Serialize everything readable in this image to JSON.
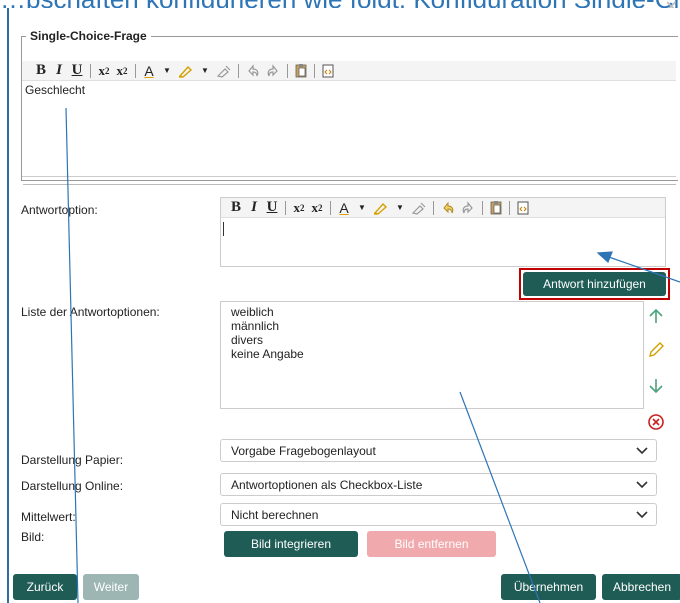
{
  "caption": "…pschaften konfigurieren wie folgt: Konfiguration Single-Choice-Frage",
  "colors": {
    "primary": "#1f5c55",
    "danger_disabled": "#f0a9ac",
    "highlight_border": "#c00000",
    "annotation_line": "#2e75b6"
  },
  "question_group": {
    "legend": "Single-Choice-Frage",
    "content": "Geschlecht"
  },
  "answer_option": {
    "label": "Antwortoption:",
    "add_button": "Antwort hinzufügen"
  },
  "options_list": {
    "label": "Liste der Antwortoptionen:",
    "items": [
      "weiblich",
      "männlich",
      "divers",
      "keine Angabe"
    ],
    "actions": [
      "arrow-up-icon",
      "pencil-icon",
      "arrow-down-icon",
      "delete-circle-icon"
    ]
  },
  "paper": {
    "label": "Darstellung Papier:",
    "value": "Vorgabe Fragebogenlayout"
  },
  "online": {
    "label": "Darstellung Online:",
    "value": "Antwortoptionen als Checkbox-Liste"
  },
  "mean": {
    "label": "Mittelwert:",
    "value": "Nicht berechnen"
  },
  "image": {
    "label": "Bild:",
    "embed_button": "Bild integrieren",
    "remove_button": "Bild entfernen"
  },
  "footer": {
    "back": "Zurück",
    "next": "Weiter",
    "apply": "Übernehmen",
    "cancel": "Abbrechen"
  }
}
